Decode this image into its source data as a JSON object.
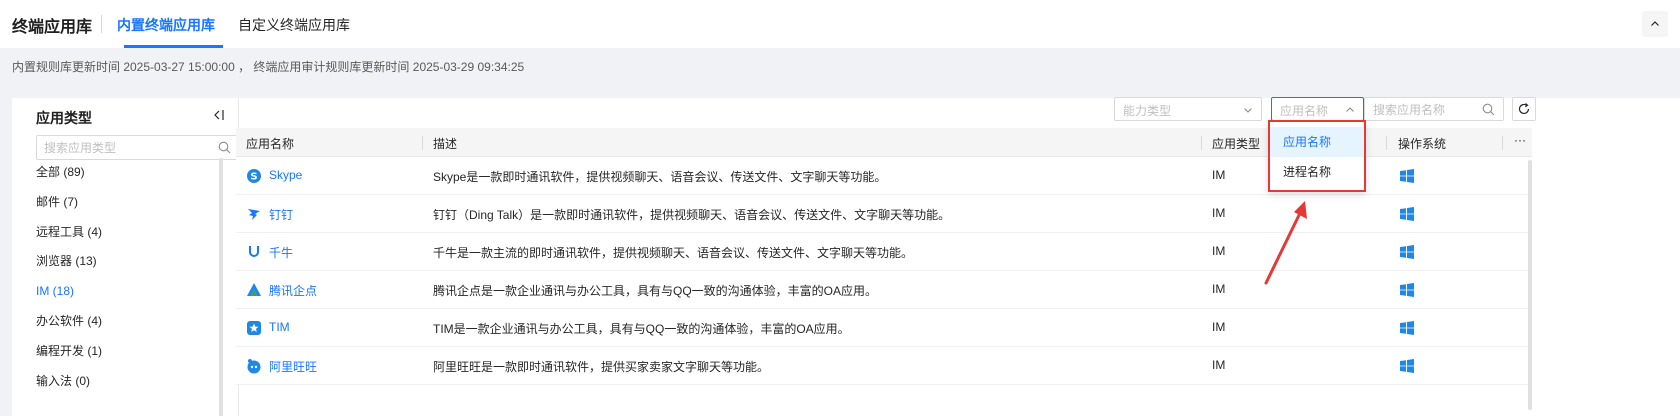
{
  "header": {
    "title": "终端应用库",
    "tabs": [
      {
        "label": "内置终端应用库",
        "active": true
      },
      {
        "label": "自定义终端应用库",
        "active": false
      }
    ]
  },
  "info": {
    "text": "内置规则库更新时间 2025-03-27 15:00:00 ，  终端应用审计规则库更新时间 2025-03-29 09:34:25"
  },
  "sidebar": {
    "title": "应用类型",
    "search_placeholder": "搜索应用类型",
    "categories": [
      {
        "label": "全部 (89)",
        "active": false
      },
      {
        "label": "邮件 (7)",
        "active": false
      },
      {
        "label": "远程工具 (4)",
        "active": false
      },
      {
        "label": "浏览器 (13)",
        "active": false
      },
      {
        "label": "IM (18)",
        "active": true
      },
      {
        "label": "办公软件 (4)",
        "active": false
      },
      {
        "label": "编程开发 (1)",
        "active": false
      },
      {
        "label": "输入法 (0)",
        "active": false
      }
    ]
  },
  "toolbar": {
    "capability_placeholder": "能力类型",
    "field_select_value": "应用名称",
    "search_placeholder": "搜索应用名称"
  },
  "dropdown": {
    "options": [
      {
        "label": "应用名称",
        "selected": true
      },
      {
        "label": "进程名称",
        "selected": false
      }
    ]
  },
  "table": {
    "columns": [
      "应用名称",
      "描述",
      "应用类型",
      "操作系统",
      "···"
    ],
    "rows": [
      {
        "name": "Skype",
        "icon": "skype-icon",
        "description": "Skype是一款即时通讯软件，提供视频聊天、语音会议、传送文件、文字聊天等功能。",
        "type": "IM",
        "os": "windows-icon"
      },
      {
        "name": "钉钉",
        "icon": "dingtalk-icon",
        "description": "钉钉（Ding Talk）是一款即时通讯软件，提供视频聊天、语音会议、传送文件、文字聊天等功能。",
        "type": "IM",
        "os": "windows-icon"
      },
      {
        "name": "千牛",
        "icon": "qianniu-icon",
        "description": "千牛是一款主流的即时通讯软件，提供视频聊天、语音会议、传送文件、文字聊天等功能。",
        "type": "IM",
        "os": "windows-icon"
      },
      {
        "name": "腾讯企点",
        "icon": "qidian-icon",
        "description": "腾讯企点是一款企业通讯与办公工具，具有与QQ一致的沟通体验，丰富的OA应用。",
        "type": "IM",
        "os": "windows-icon"
      },
      {
        "name": "TIM",
        "icon": "tim-icon",
        "description": "TIM是一款企业通讯与办公工具，具有与QQ一致的沟通体验，丰富的OA应用。",
        "type": "IM",
        "os": "windows-icon"
      },
      {
        "name": "阿里旺旺",
        "icon": "wangwang-icon",
        "description": "阿里旺旺是一款即时通讯软件，提供买家卖家文字聊天等功能。",
        "type": "IM",
        "os": "windows-icon"
      }
    ]
  },
  "colors": {
    "accent": "#1677ff",
    "highlight_border": "#e53935",
    "windows": "#1e88e5"
  }
}
